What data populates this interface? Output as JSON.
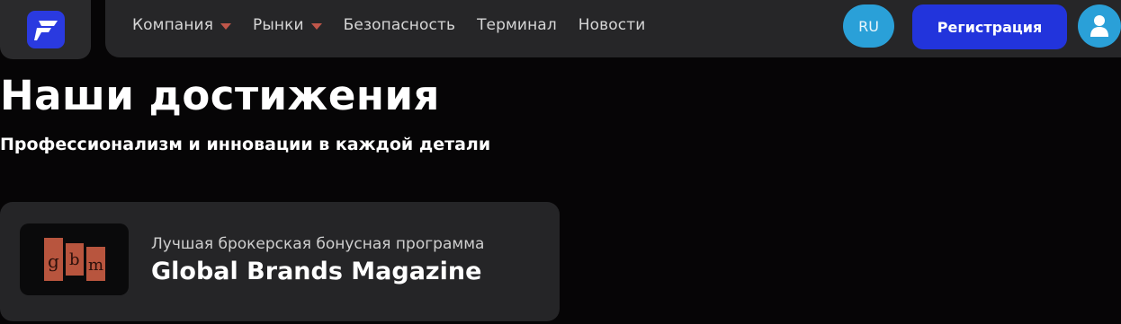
{
  "header": {
    "logo": {
      "icon": "brand-logo-icon",
      "color": "#2a3ae0"
    },
    "nav": [
      {
        "label": "Компания",
        "dropdown": true
      },
      {
        "label": "Рынки",
        "dropdown": true
      },
      {
        "label": "Безопасность",
        "dropdown": false
      },
      {
        "label": "Терминал",
        "dropdown": false
      },
      {
        "label": "Новости",
        "dropdown": false
      }
    ],
    "language": "RU",
    "register_label": "Регистрация",
    "profile_icon": "user-icon"
  },
  "main": {
    "title": "Наши достижения",
    "subtitle": "Профессионализм и инновации в каждой детали",
    "achievements": [
      {
        "logo_text": "gbm",
        "caption": "Лучшая брокерская бонусная программа",
        "title": "Global Brands Magazine"
      }
    ]
  },
  "colors": {
    "background": "#060506",
    "accent_blue": "#2234dc",
    "accent_cyan": "#2aa0d8",
    "caret": "#c0564a",
    "card": "#252527"
  }
}
